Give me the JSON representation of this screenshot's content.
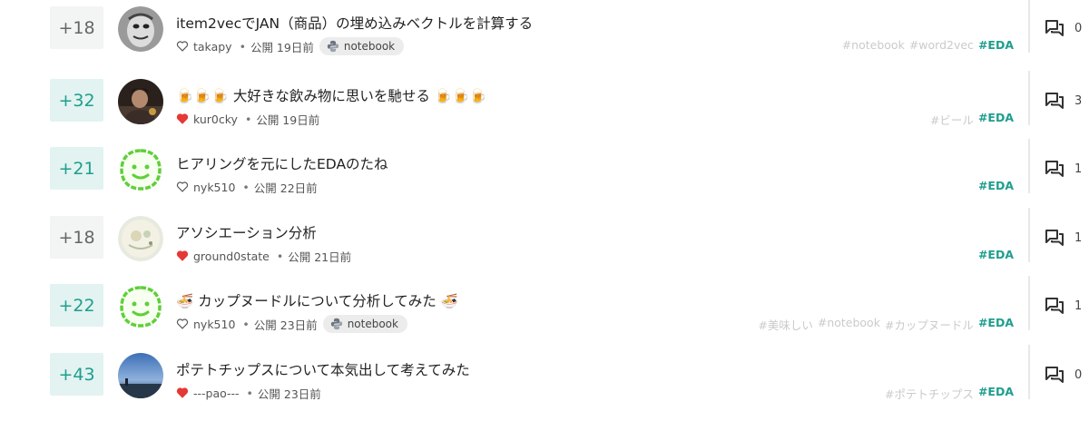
{
  "items": [
    {
      "votes": "+18",
      "vote_style": "gray",
      "avatar": "avatar-face-sketch",
      "title": "item2vecでJAN（商品）の埋め込みベクトルを計算する",
      "liked": false,
      "author": "takapy",
      "published": "公開 19日前",
      "notebook_label": "notebook",
      "tags": [
        "#notebook",
        "#word2vec"
      ],
      "main_tag": "#EDA",
      "comments": "0"
    },
    {
      "votes": "+32",
      "vote_style": "teal",
      "avatar": "avatar-photo-person",
      "title": "🍺🍺🍺 大好きな飲み物に思いを馳せる 🍺🍺🍺",
      "liked": true,
      "author": "kur0cky",
      "published": "公開 19日前",
      "notebook_label": "",
      "tags": [
        "#ビール"
      ],
      "main_tag": "#EDA",
      "comments": "3"
    },
    {
      "votes": "+21",
      "vote_style": "teal",
      "avatar": "avatar-green-smiley",
      "title": "ヒアリングを元にしたEDAのたね",
      "liked": false,
      "author": "nyk510",
      "published": "公開 22日前",
      "notebook_label": "",
      "tags": [],
      "main_tag": "#EDA",
      "comments": "1"
    },
    {
      "votes": "+18",
      "vote_style": "gray",
      "avatar": "avatar-pale-art",
      "title": "アソシエーション分析",
      "liked": true,
      "author": "ground0state",
      "published": "公開 21日前",
      "notebook_label": "",
      "tags": [],
      "main_tag": "#EDA",
      "comments": "1"
    },
    {
      "votes": "+22",
      "vote_style": "teal",
      "avatar": "avatar-green-smiley",
      "title": "🍜 カップヌードルについて分析してみた 🍜",
      "liked": false,
      "author": "nyk510",
      "published": "公開 23日前",
      "notebook_label": "notebook",
      "tags": [
        "#美味しい",
        "#notebook",
        "#カップヌードル"
      ],
      "main_tag": "#EDA",
      "comments": "1"
    },
    {
      "votes": "+43",
      "vote_style": "teal",
      "avatar": "avatar-photo-sky",
      "title": "ポテトチップスについて本気出して考えてみた",
      "liked": true,
      "author": "---pao---",
      "published": "公開 23日前",
      "notebook_label": "",
      "tags": [
        "#ポテトチップス"
      ],
      "main_tag": "#EDA",
      "comments": "0"
    }
  ],
  "colors": {
    "accent": "#1f9e8d",
    "vote_teal_bg": "#e2f3f1",
    "vote_gray_bg": "#f3f4f4",
    "heart_red": "#e53935",
    "tag_gray": "#c9cbcc"
  },
  "icons": {
    "like": "heart-icon",
    "notebook": "python-icon",
    "comments": "comment-bubbles-icon"
  }
}
